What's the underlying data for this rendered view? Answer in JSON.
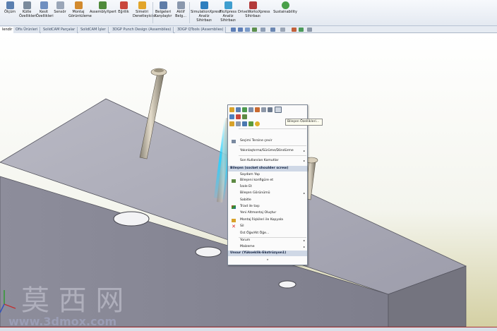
{
  "ribbon": {
    "buttons": [
      {
        "label": "Ölçüm",
        "icon": "measure-icon"
      },
      {
        "label": "Kütle Özellikleri",
        "icon": "mass-properties-icon"
      },
      {
        "label": "Kesit Özellikleri",
        "icon": "section-properties-icon"
      },
      {
        "label": "Sensör",
        "icon": "sensor-icon"
      },
      {
        "label": "Montaj Görüntüleme",
        "icon": "assembly-visualization-icon"
      },
      {
        "label": "AssemblyXpert",
        "icon": "assemblyxpert-icon"
      },
      {
        "label": "Eğrilik",
        "icon": "curvature-icon"
      },
      {
        "label": "Simetri Denetleyicisi",
        "icon": "symmetry-check-icon"
      },
      {
        "label": "Belgeleri Karşılaştır",
        "icon": "compare-documents-icon"
      },
      {
        "label": "Aktif Belg...",
        "icon": "active-document-icon"
      },
      {
        "label": "SimulationXpress Analiz Sihirbazı",
        "icon": "simulationxpress-icon"
      },
      {
        "label": "FloXpress Analiz Sihirbazı",
        "icon": "floxpress-icon"
      },
      {
        "label": "DriveWorksXpress Sihirbazı",
        "icon": "driveworksxpress-icon"
      },
      {
        "label": "Sustainability",
        "icon": "sustainability-icon"
      }
    ]
  },
  "tabs": [
    {
      "label": "lendir"
    },
    {
      "label": "Ofis Ürünleri"
    },
    {
      "label": "SolidCAM Parçalar"
    },
    {
      "label": "SolidCAM İşler"
    },
    {
      "label": "3DGP Punch Design (Assemblies)"
    },
    {
      "label": "3DGP QTools (Assemblies)"
    }
  ],
  "tooltip": {
    "text": "Bileşen Özellikleri..."
  },
  "context_menu": {
    "items": [
      {
        "type": "item",
        "label": "Seçimi Tersine çevir",
        "icon": "invert-selection-icon",
        "arrow": ""
      },
      {
        "type": "item",
        "label": "Yakınlaştırma/Sürüme/Döndürme",
        "icon": "",
        "arrow": "▸"
      },
      {
        "type": "item",
        "label": "Son Kullanılan Komutlar",
        "icon": "",
        "arrow": "▸"
      },
      {
        "type": "header",
        "label": "Bileşen (socket shoulder screw)"
      },
      {
        "type": "item",
        "label": "Saydam Yap",
        "icon": "",
        "arrow": ""
      },
      {
        "type": "item",
        "label": "Bileşeni konfigüre et",
        "icon": "configure-component-icon",
        "arrow": ""
      },
      {
        "type": "item",
        "label": "İzole Et",
        "icon": "",
        "arrow": ""
      },
      {
        "type": "item",
        "label": "Bileşen Görünümü",
        "icon": "",
        "arrow": "▸"
      },
      {
        "type": "item",
        "label": "Sabitle",
        "icon": "",
        "arrow": ""
      },
      {
        "type": "item",
        "label": "Triad ile taşı",
        "icon": "triad-icon",
        "arrow": ""
      },
      {
        "type": "item",
        "label": "Yeni Altmontaj Oluştur",
        "icon": "",
        "arrow": ""
      },
      {
        "type": "item",
        "label": "Montaj İlişkileri ile Kopyala",
        "icon": "copy-with-mates-icon",
        "arrow": ""
      },
      {
        "type": "item",
        "label": "Sil",
        "icon": "delete-icon",
        "arrow": ""
      },
      {
        "type": "item",
        "label": "Üst Öğe/Alt Öğe...",
        "icon": "",
        "arrow": ""
      },
      {
        "type": "item",
        "label": "Yorum",
        "icon": "",
        "arrow": "▸"
      },
      {
        "type": "item",
        "label": "Malzeme",
        "icon": "",
        "arrow": "▸"
      },
      {
        "type": "header",
        "label": "Unsur (Yükseklik-Ekstrüzyon1)"
      },
      {
        "type": "more",
        "label": "»"
      }
    ]
  },
  "watermark": {
    "chars": "莫 西 网",
    "url": "www.3dmox.com"
  },
  "colors": {
    "ribbon_bg": "#e9eef5",
    "menu_header": "#cfd8e6",
    "plate_top": "#aaaab6",
    "plate_front": "#8a8a97",
    "highlight": "#27d1ff",
    "status_border": "#aa3333"
  }
}
